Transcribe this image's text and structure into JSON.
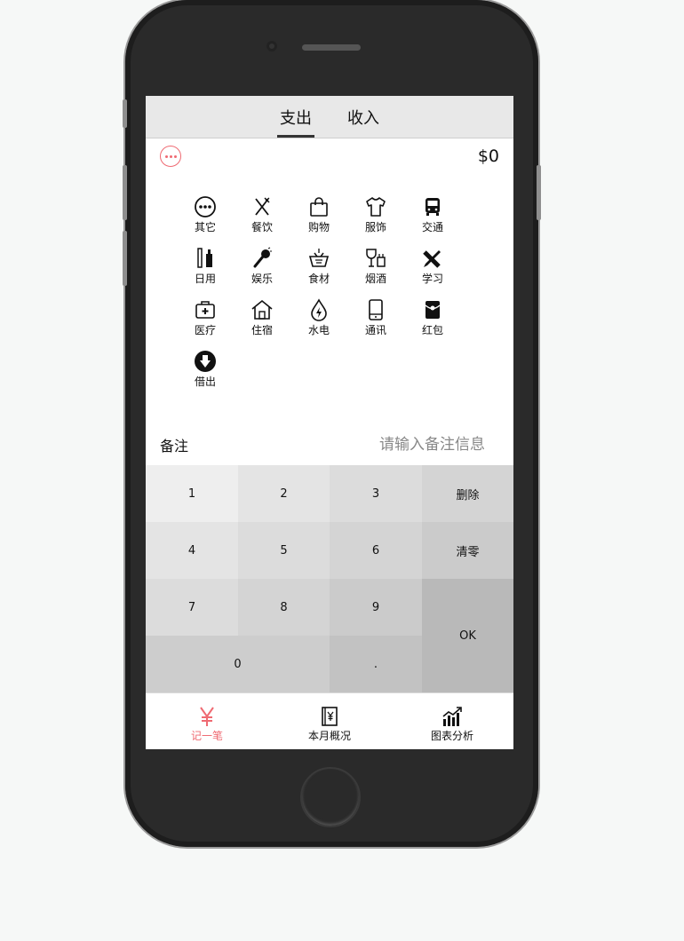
{
  "tabs": {
    "expense": "支出",
    "income": "收入"
  },
  "amount": "$0",
  "categories": [
    "其它",
    "餐饮",
    "购物",
    "服饰",
    "交通",
    "日用",
    "娱乐",
    "食材",
    "烟酒",
    "学习",
    "医疗",
    "住宿",
    "水电",
    "通讯",
    "红包",
    "借出"
  ],
  "memo": {
    "label": "备注",
    "placeholder": "请输入备注信息"
  },
  "keypad": {
    "k1": "1",
    "k2": "2",
    "k3": "3",
    "delete": "删除",
    "k4": "4",
    "k5": "5",
    "k6": "6",
    "clear": "清零",
    "k7": "7",
    "k8": "8",
    "k9": "9",
    "ok": "OK",
    "k0": "0",
    "dot": "."
  },
  "nav": {
    "record": "记一笔",
    "month": "本月概况",
    "charts": "图表分析"
  },
  "colors": {
    "accent": "#ef6a72"
  }
}
